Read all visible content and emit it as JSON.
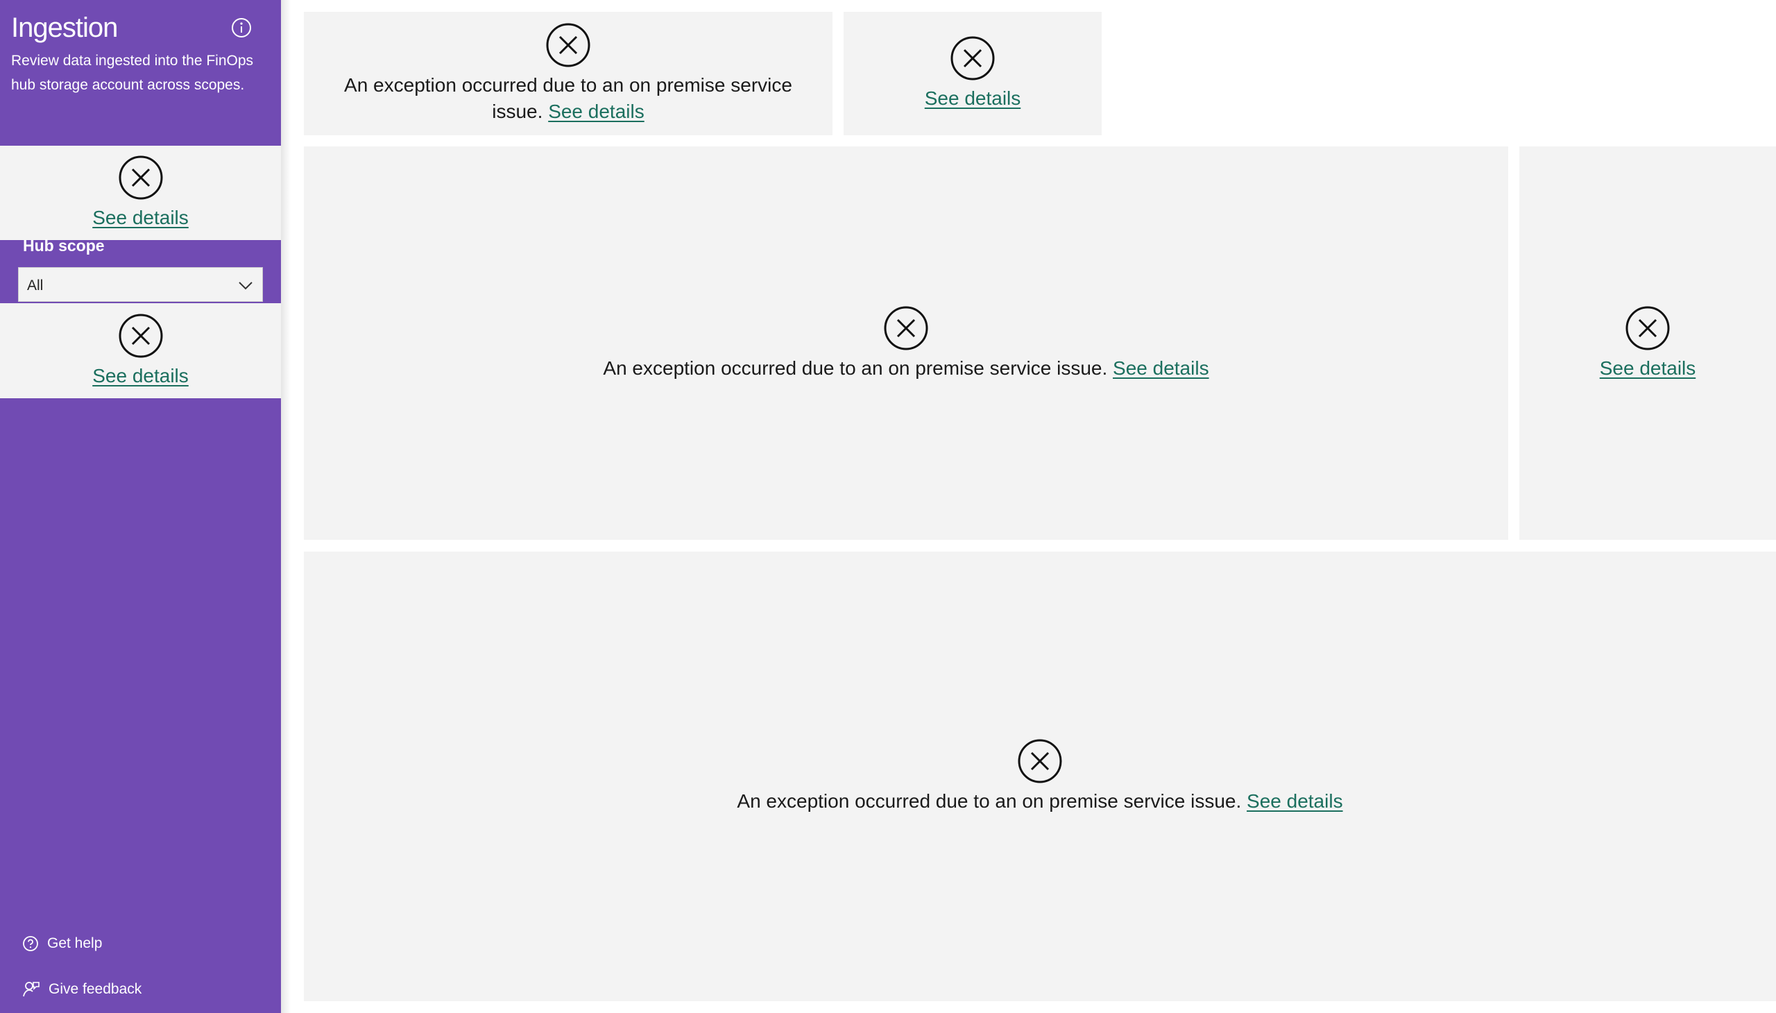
{
  "sidebar": {
    "title": "Ingestion",
    "description": "Review data ingested into the FinOps hub storage account across scopes.",
    "info_icon": "info-icon",
    "background": "#714bb3",
    "filter": {
      "label": "Hub scope",
      "value": "All",
      "icon": "chevron-down-icon"
    },
    "footer": {
      "help": "Get help",
      "help_icon": "help-circle-icon",
      "feedback": "Give feedback",
      "feedback_icon": "feedback-person-icon"
    }
  },
  "errors": {
    "message": "An exception occurred due to an on premise service issue.",
    "wrapped_first": "An exception occurred due to an on premise service",
    "wrapped_second": "issue.",
    "link": "See details",
    "icon": "error-circle-icon",
    "link_color": "#1b6f5e",
    "tile_color": "#f3f3f3"
  }
}
